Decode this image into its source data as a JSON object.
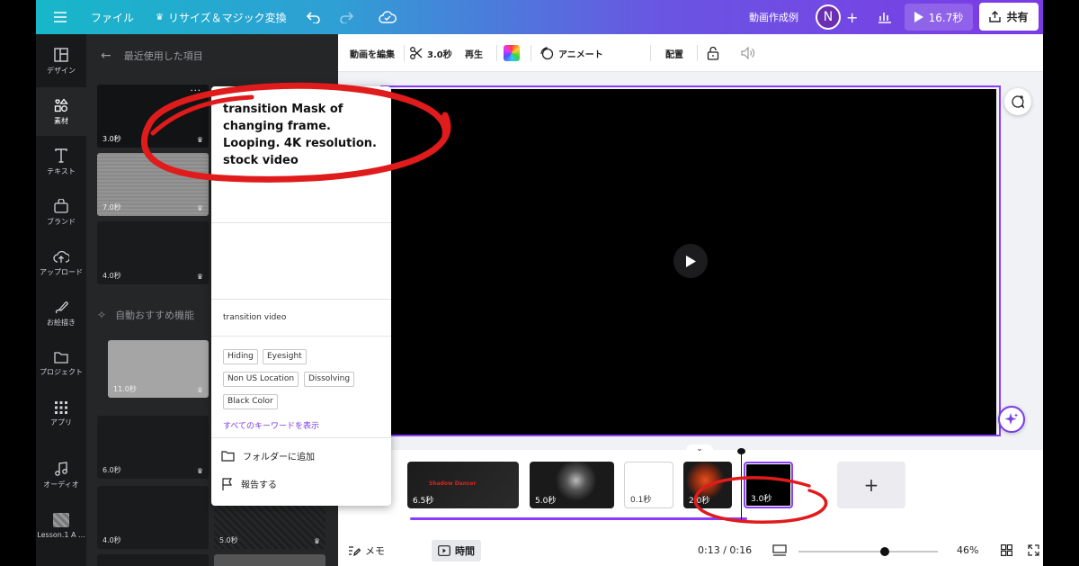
{
  "topbar": {
    "file_label": "ファイル",
    "resize_label": "リサイズ＆マジック変換",
    "project_title": "動画作成例",
    "avatar_initial": "N",
    "play_duration": "16.7秒",
    "share_label": "共有"
  },
  "rail": {
    "items": [
      {
        "label": "デザイン",
        "icon": "layout-icon"
      },
      {
        "label": "素材",
        "icon": "elements-icon"
      },
      {
        "label": "テキスト",
        "icon": "text-icon"
      },
      {
        "label": "ブランド",
        "icon": "brand-icon"
      },
      {
        "label": "アップロード",
        "icon": "upload-icon"
      },
      {
        "label": "お絵描き",
        "icon": "draw-icon"
      },
      {
        "label": "プロジェクト",
        "icon": "folder-icon"
      },
      {
        "label": "アプリ",
        "icon": "apps-icon"
      },
      {
        "label": "オーディオ",
        "icon": "audio-icon"
      },
      {
        "label": "Lesson.1 A ..."
      }
    ]
  },
  "panel": {
    "back_title": "最近使用した項目",
    "auto_suggest": "自動おすすめ機能",
    "tiles": [
      {
        "duration": "3.0秒"
      },
      {
        "duration": "7.0秒"
      },
      {
        "duration": "4.0秒"
      },
      {
        "duration": "11.0秒"
      },
      {
        "duration": "6.0秒"
      },
      {
        "duration": "4.0秒"
      },
      {
        "duration": "5.0秒"
      }
    ]
  },
  "popup": {
    "title": "transition Mask of changing frame. Looping. 4K resolution. stock video",
    "subtitle": "transition video",
    "keywords": [
      "Hiding",
      "Eyesight",
      "Non US Location",
      "Dissolving",
      "Black Color"
    ],
    "show_all_keywords": "すべてのキーワードを表示",
    "add_to_folder": "フォルダーに追加",
    "report": "報告する"
  },
  "toolbar": {
    "edit_video": "動画を編集",
    "duration": "3.0秒",
    "playback": "再生",
    "animate": "アニメート",
    "position": "配置"
  },
  "timeline": {
    "clips": [
      {
        "duration": "6.5秒",
        "caption": "Shadow Dancer"
      },
      {
        "duration": "5.0秒"
      },
      {
        "duration": "0.1秒"
      },
      {
        "duration": "2.0秒"
      },
      {
        "duration": "3.0秒"
      }
    ]
  },
  "bottombar": {
    "notes_label": "メモ",
    "timer_label": "時間",
    "time_readout": "0:13 / 0:16",
    "zoom_percent": "46%",
    "zoom_fraction": 0.62
  },
  "colors": {
    "accent": "#8b3dff",
    "annotation": "#e01b1b"
  }
}
